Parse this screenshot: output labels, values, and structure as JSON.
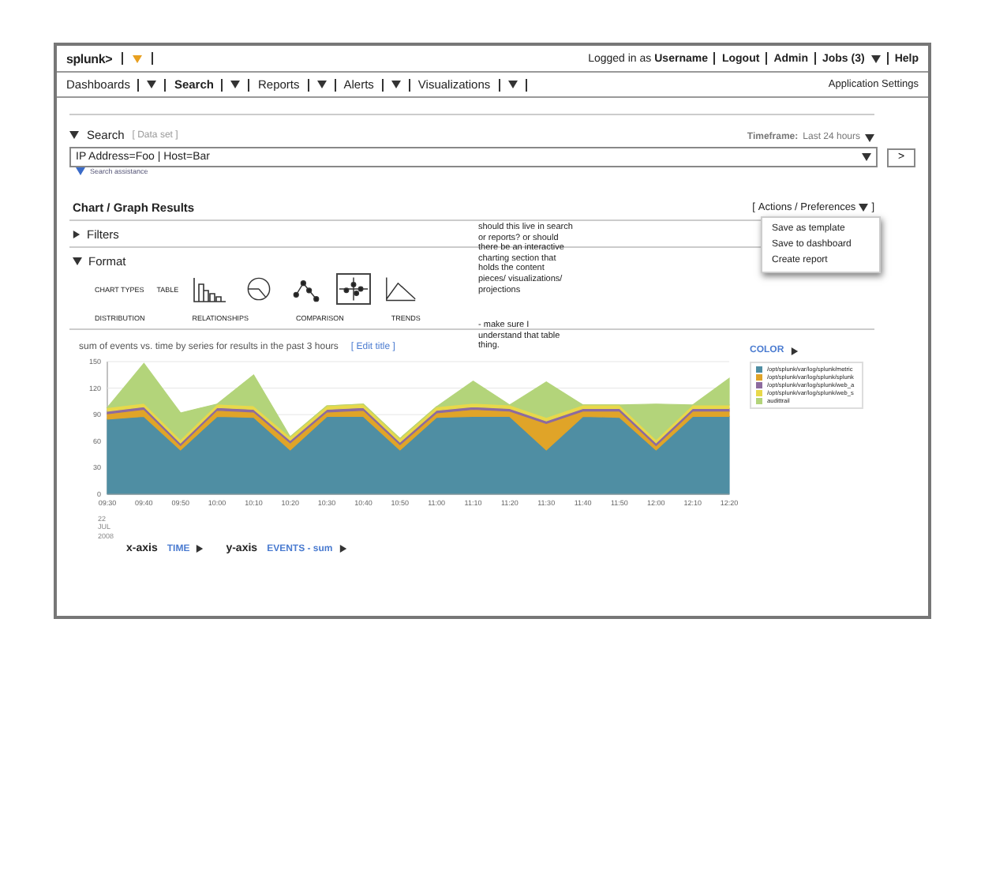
{
  "header": {
    "logo": "splunk>",
    "login_text": "Logged in as **Username**",
    "links": [
      {
        "label": "Logout",
        "dropdown": false
      },
      {
        "label": "Admin",
        "dropdown": false
      },
      {
        "label": "Jobs (3)",
        "dropdown": true
      },
      {
        "label": "Help",
        "dropdown": false
      }
    ]
  },
  "nav": {
    "items": [
      {
        "label": "Dashboards",
        "selected": false
      },
      {
        "label": "Search",
        "selected": true
      },
      {
        "label": "Reports",
        "selected": false
      },
      {
        "label": "Alerts",
        "selected": false
      },
      {
        "label": "Visualizations",
        "selected": false
      }
    ],
    "settings": "Application Settings"
  },
  "search": {
    "title": "Search",
    "expanded": true,
    "dataset": "[ Data set ]",
    "timeframe_label": "Timeframe:",
    "timeframe_value": "Last 24 hours",
    "query": "IP Address=Foo | Host=Bar",
    "go": ">",
    "assistance": "Search assistance"
  },
  "results": {
    "title": "Chart / Graph Results",
    "actions": {
      "open": "[",
      "label": "Actions / Preferences",
      "close": "]"
    },
    "menu": {
      "open": true,
      "items": [
        "Save as template",
        "Save to dashboard",
        "Create report"
      ]
    },
    "sections": [
      {
        "label": "Filters",
        "expanded": false
      },
      {
        "label": "Format",
        "expanded": true
      }
    ],
    "format": {
      "chart_types_label": "CHART TYPES",
      "table_label": "TABLE",
      "types": [
        {
          "kind": "bar",
          "selected": false
        },
        {
          "kind": "pie",
          "selected": false
        },
        {
          "kind": "scatter",
          "selected": false
        },
        {
          "kind": "grid",
          "selected": true
        },
        {
          "kind": "line",
          "selected": false
        }
      ],
      "captions": [
        "DISTRIBUTION",
        "RELATIONSHIPS",
        "COMPARISON",
        "TRENDS"
      ]
    },
    "notes": [
      "should this live in search or reports? or should there be an interactive charting section that holds the content pieces/ visualizations/ projections",
      "- make sure I understand that table thing."
    ],
    "chart": {
      "title": "sum of events vs. time by series for results in the past 3 hours",
      "edit": "[ Edit title ]",
      "color_label": "COLOR",
      "date": "22 JUL 2008",
      "x_axis": {
        "label": "x-axis",
        "value": "TIME"
      },
      "y_axis": {
        "label": "y-axis",
        "value": "EVENTS - sum"
      },
      "chart_data": {
        "type": "area",
        "stacked": true,
        "grid": true,
        "categories": [
          "09:30",
          "09:40",
          "09:50",
          "10:00",
          "10:10",
          "10:20",
          "10:30",
          "10:40",
          "10:50",
          "11:00",
          "11:10",
          "11:20",
          "11:30",
          "11:40",
          "11:50",
          "12:00",
          "12:10",
          "12:20"
        ],
        "ylim": [
          0,
          150
        ],
        "yticks": [
          0,
          30,
          60,
          90,
          120,
          150
        ],
        "series": [
          {
            "name": "/opt/splunk/var/log/splunk/metric",
            "color": "#4f8ea3",
            "values": [
              85,
              88,
              50,
              88,
              87,
              50,
              88,
              88,
              50,
              87,
              88,
              88,
              50,
              88,
              87,
              50,
              88,
              88
            ]
          },
          {
            "name": "/opt/splunk/var/log/splunk/splunk",
            "color": "#e0a428",
            "values": [
              6,
              8,
              5,
              7,
              6,
              8,
              5,
              7,
              6,
              5,
              8,
              6,
              30,
              6,
              7,
              5,
              6,
              6
            ]
          },
          {
            "name": "/opt/splunk/var/log/splunk/web_a",
            "color": "#8d6b9f",
            "values": [
              3,
              3,
              3,
              3,
              3,
              3,
              3,
              3,
              3,
              3,
              3,
              3,
              3,
              3,
              3,
              3,
              3,
              3
            ]
          },
          {
            "name": "/opt/splunk/var/log/splunk/web_s",
            "color": "#e8d84a",
            "values": [
              4,
              4,
              4,
              4,
              4,
              4,
              4,
              4,
              4,
              4,
              4,
              4,
              4,
              4,
              4,
              4,
              4,
              4
            ]
          },
          {
            "name": "audittrail",
            "color": "#b3d47a",
            "values": [
              0,
              45,
              30,
              0,
              35,
              0,
              0,
              0,
              0,
              0,
              25,
              0,
              40,
              0,
              0,
              40,
              0,
              30
            ]
          }
        ]
      }
    }
  }
}
